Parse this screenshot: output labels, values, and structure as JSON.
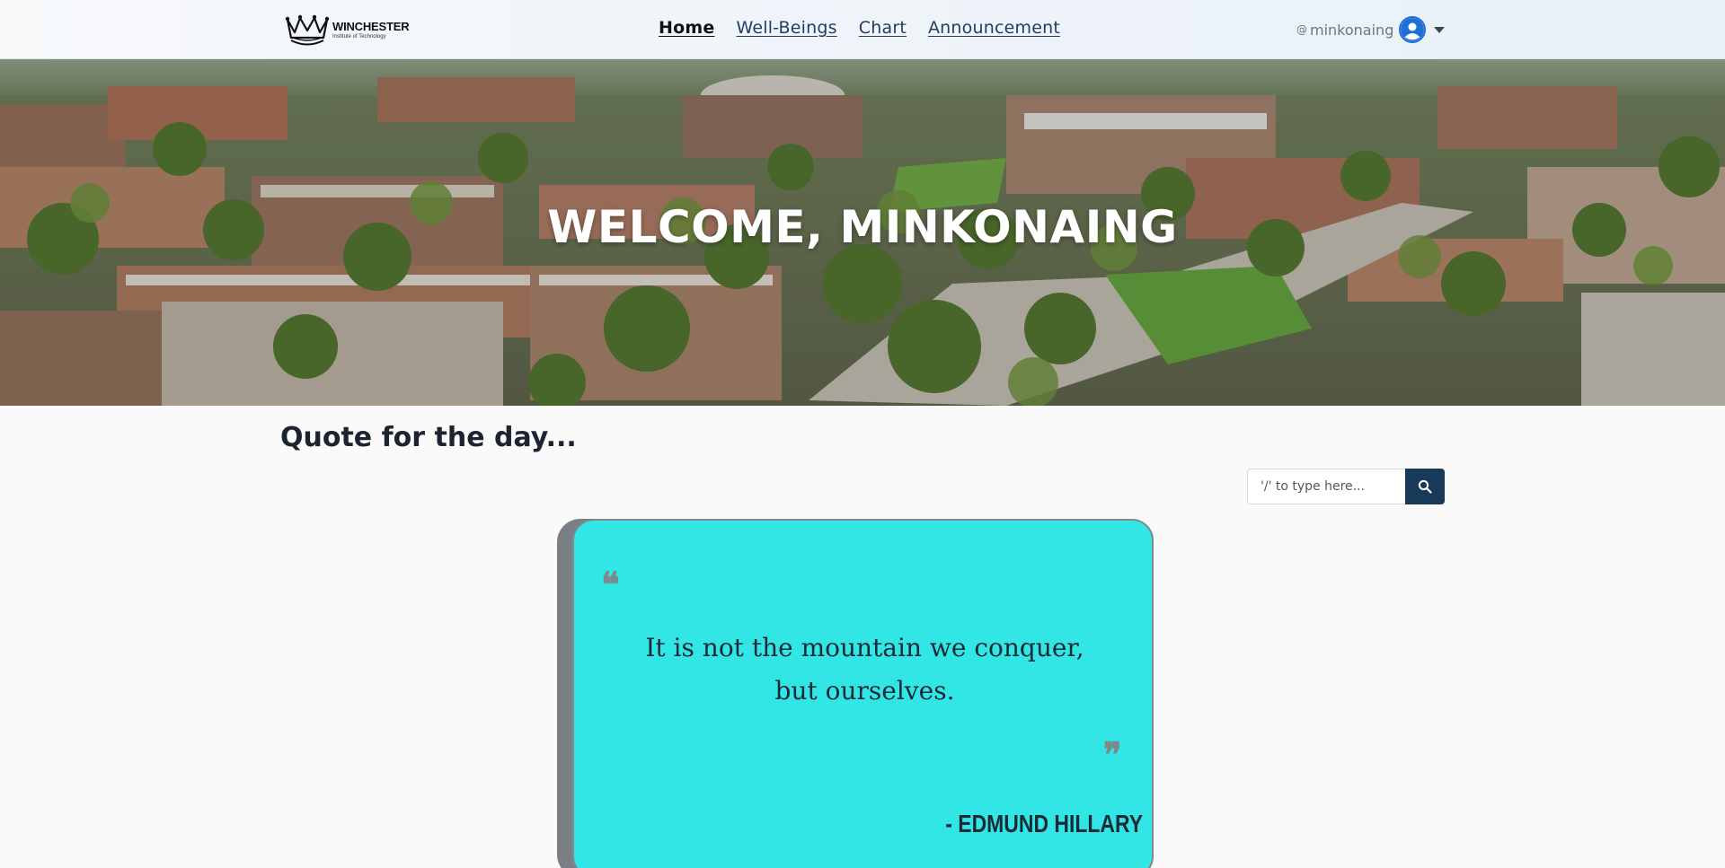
{
  "brand": {
    "name": "WINCHESTER",
    "subtitle": "Institute of Technology",
    "icon": "crown-icon"
  },
  "nav": {
    "items": [
      {
        "label": "Home",
        "active": true
      },
      {
        "label": "Well-Beings",
        "active": false
      },
      {
        "label": "Chart",
        "active": false
      },
      {
        "label": "Announcement",
        "active": false
      }
    ]
  },
  "user": {
    "at_symbol": "@",
    "username": "minkonaing",
    "avatar_icon": "user-circle-icon",
    "menu_icon": "caret-down-icon"
  },
  "hero": {
    "title": "WELCOME, MINKONAING"
  },
  "quote_section": {
    "title": "Quote for the day...",
    "search": {
      "placeholder": "'/' to type here...",
      "value": "",
      "button_icon": "search-icon"
    }
  },
  "quote": {
    "open_mark": "❝",
    "text": "It is not the mountain we conquer, but ourselves.",
    "close_mark": "❞",
    "author": "- EDMUND HILLARY"
  },
  "colors": {
    "card": "#32e6e6",
    "card_shadow": "#7a7f86",
    "search_button": "#173a58",
    "avatar_ring": "#1e6fd6",
    "nav_link": "#1f3e62"
  }
}
